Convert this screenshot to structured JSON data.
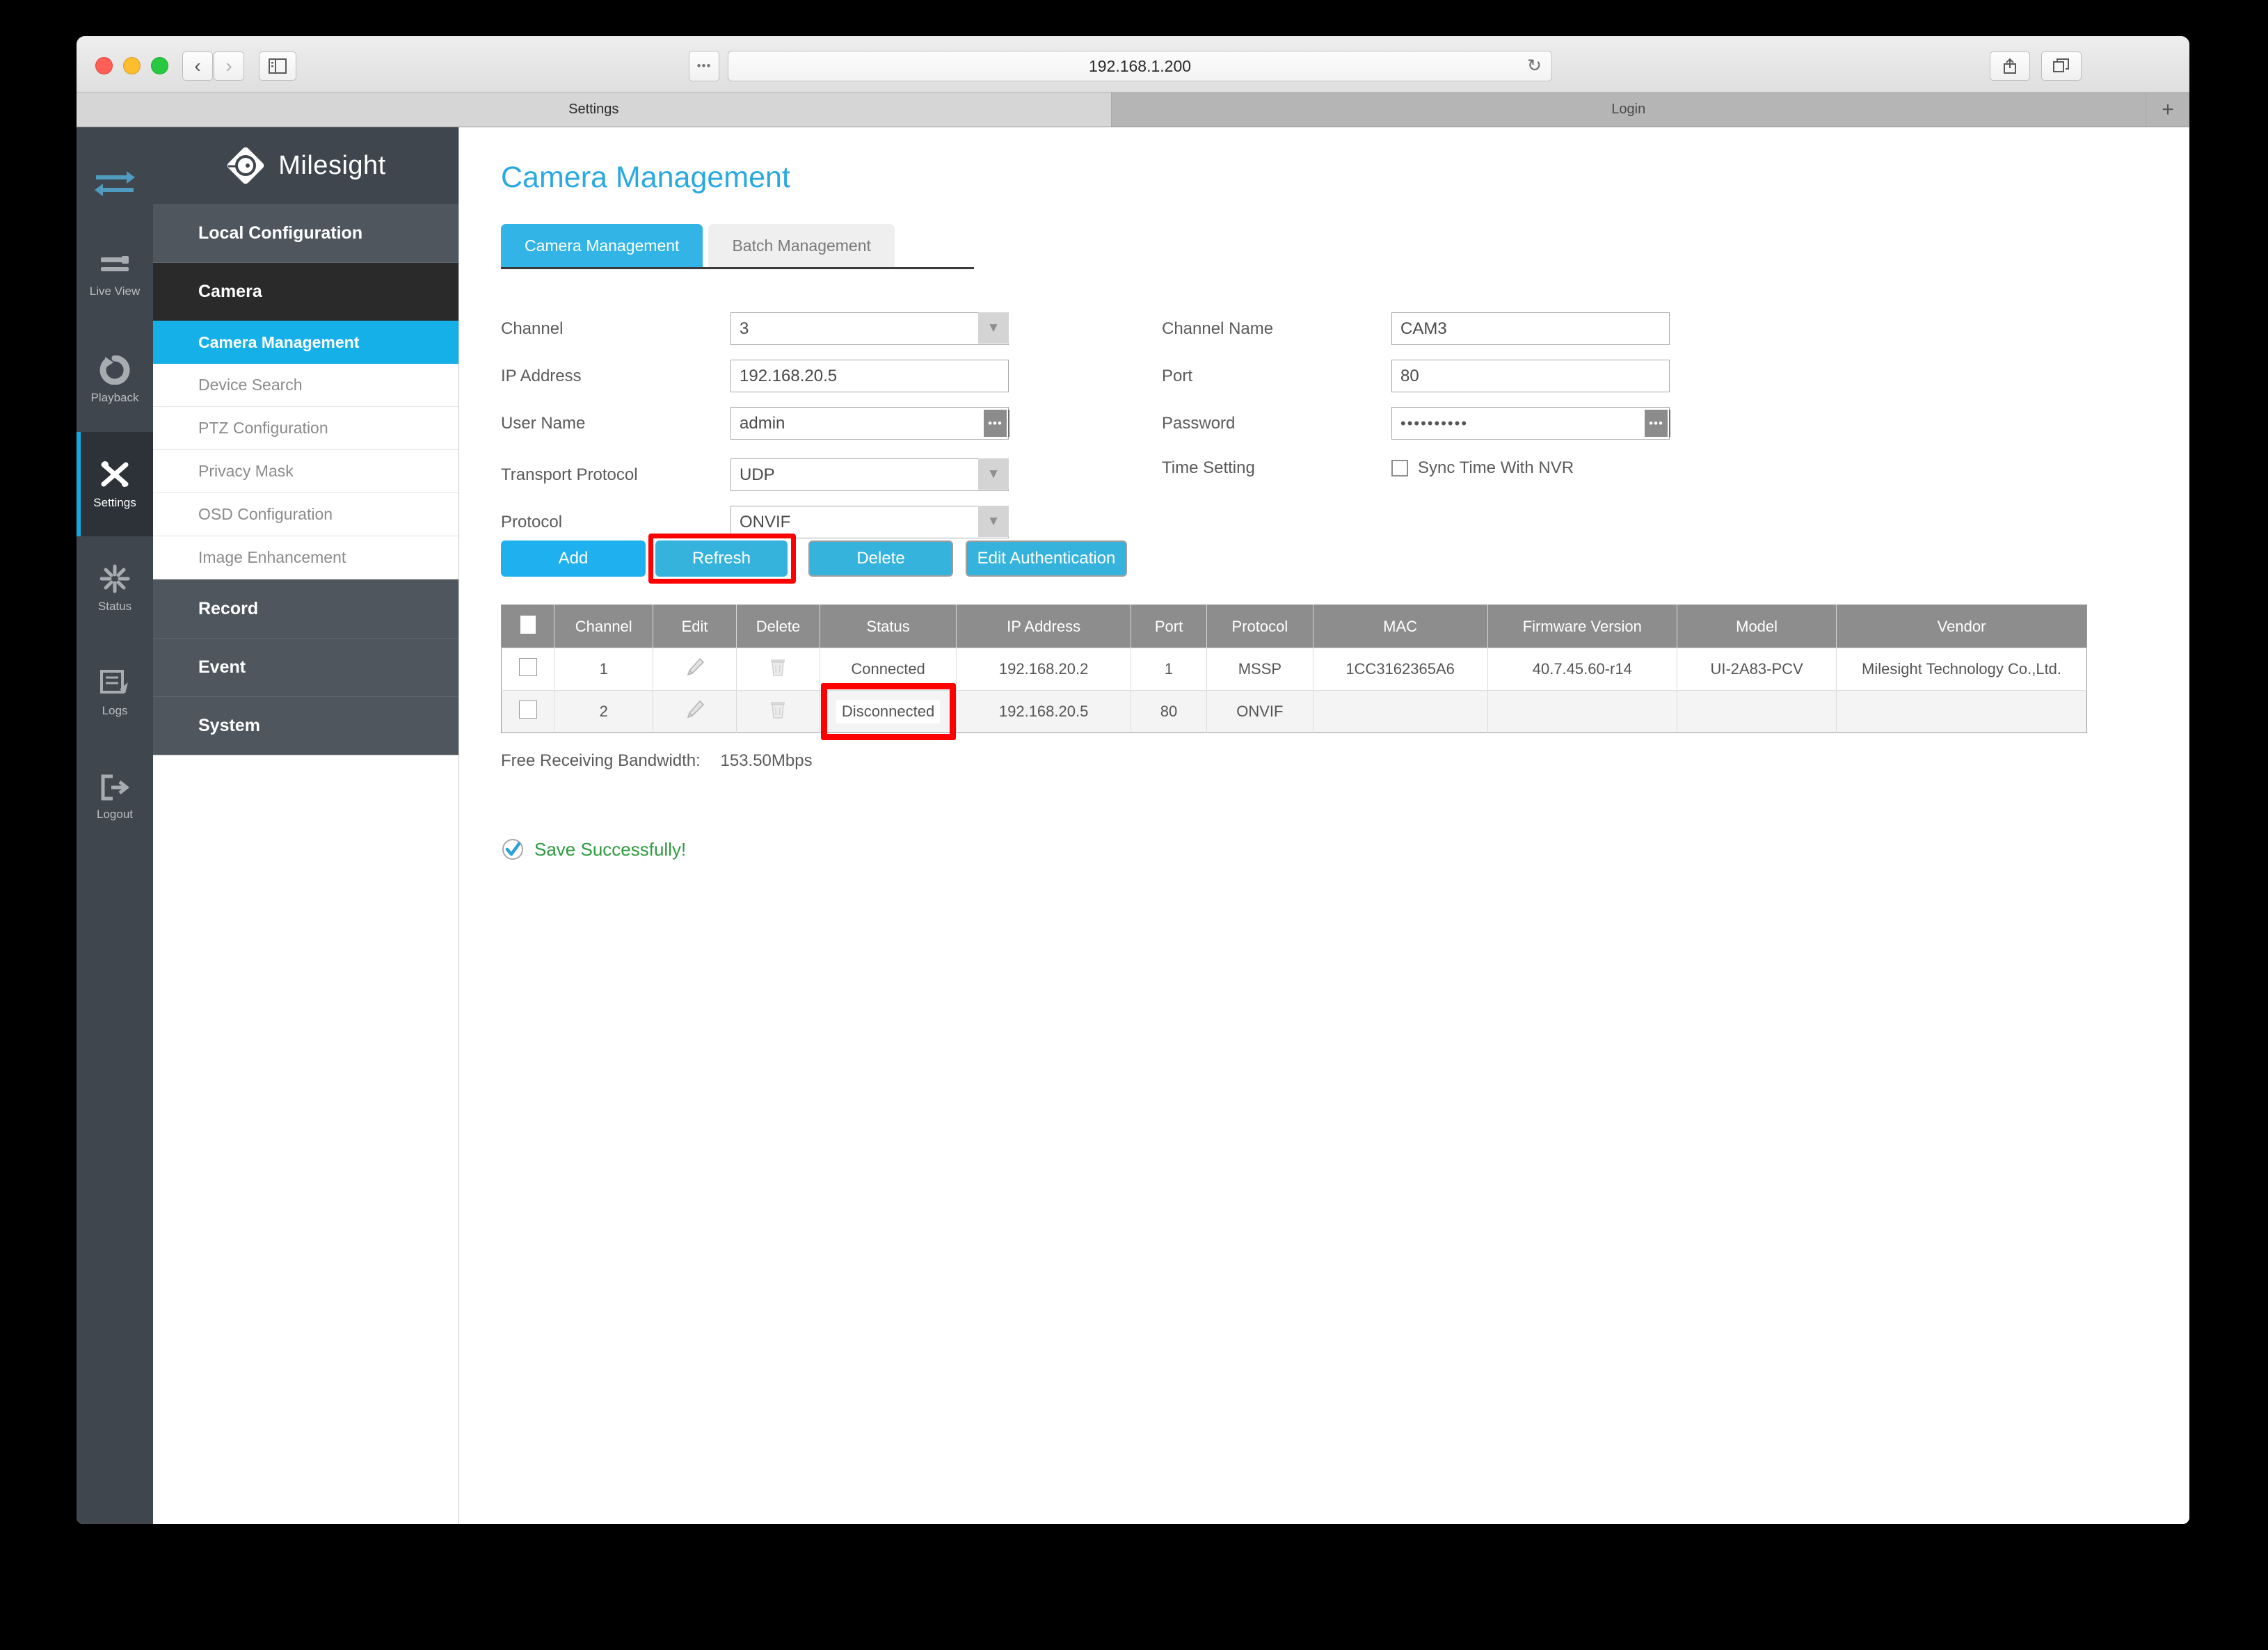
{
  "browser": {
    "url": "192.168.1.200",
    "reload_icon": "reload-icon",
    "back_icon": "chevron-left-icon",
    "forward_icon": "chevron-right-icon",
    "sidebar_icon": "sidebar-toggle-icon",
    "dots_icon": "more-icon",
    "share_icon": "share-icon",
    "tabs_icon": "show-tabs-icon",
    "newtab_label": "+",
    "tabs": [
      {
        "label": "Settings",
        "active": true
      },
      {
        "label": "Login",
        "active": false
      }
    ]
  },
  "rail": {
    "logo_icon": "transfer-arrows-icon",
    "items": [
      {
        "label": "Live View",
        "icon": "live-view-icon",
        "active": false
      },
      {
        "label": "Playback",
        "icon": "playback-icon",
        "active": false
      },
      {
        "label": "Settings",
        "icon": "settings-tools-icon",
        "active": true
      },
      {
        "label": "Status",
        "icon": "status-icon",
        "active": false
      },
      {
        "label": "Logs",
        "icon": "logs-icon",
        "active": false
      },
      {
        "label": "Logout",
        "icon": "logout-icon",
        "active": false
      }
    ]
  },
  "brand": {
    "name": "Milesight",
    "logo_icon": "milesight-logo-icon"
  },
  "nav": {
    "groups": [
      {
        "label": "Local Configuration",
        "open": false
      },
      {
        "label": "Camera",
        "open": true
      },
      {
        "label": "Record",
        "open": false
      },
      {
        "label": "Event",
        "open": false
      },
      {
        "label": "System",
        "open": false
      }
    ],
    "camera_subitems": [
      {
        "label": "Camera Management",
        "active": true
      },
      {
        "label": "Device Search",
        "active": false
      },
      {
        "label": "PTZ Configuration",
        "active": false
      },
      {
        "label": "Privacy Mask",
        "active": false
      },
      {
        "label": "OSD Configuration",
        "active": false
      },
      {
        "label": "Image Enhancement",
        "active": false
      }
    ]
  },
  "page": {
    "title": "Camera Management",
    "tabs": [
      {
        "label": "Camera Management",
        "active": true
      },
      {
        "label": "Batch Management",
        "active": false
      }
    ]
  },
  "form": {
    "channel_label": "Channel",
    "channel_value": "3",
    "ip_label": "IP Address",
    "ip_value": "192.168.20.5",
    "username_label": "User Name",
    "username_value": "admin",
    "transport_label": "Transport Protocol",
    "transport_value": "UDP",
    "protocol_label": "Protocol",
    "protocol_value": "ONVIF",
    "channel_name_label": "Channel Name",
    "channel_name_value": "CAM3",
    "port_label": "Port",
    "port_value": "80",
    "password_label": "Password",
    "password_value": "••••••••••",
    "time_setting_label": "Time Setting",
    "sync_time_label": "Sync Time With NVR",
    "sync_time_checked": false,
    "caret_icon": "chevron-down-icon",
    "dots_icon": "more-dots-icon"
  },
  "buttons": {
    "add": "Add",
    "refresh": "Refresh",
    "delete": "Delete",
    "edit_authentication": "Edit Authentication",
    "highlight_color": "#ff0000"
  },
  "table": {
    "columns": [
      "",
      "Channel",
      "Edit",
      "Delete",
      "Status",
      "IP Address",
      "Port",
      "Protocol",
      "MAC",
      "Firmware Version",
      "Model",
      "Vendor"
    ],
    "rows": [
      {
        "channel": "1",
        "edit_icon": "pencil-icon",
        "delete_icon": "trash-icon",
        "status": "Connected",
        "status_flagged": false,
        "ip_address": "192.168.20.2",
        "port": "1",
        "protocol": "MSSP",
        "mac": "1CC3162365A6",
        "firmware_version": "40.7.45.60-r14",
        "model": "UI-2A83-PCV",
        "vendor": "Milesight Technology Co.,Ltd."
      },
      {
        "channel": "2",
        "edit_icon": "pencil-icon",
        "delete_icon": "trash-icon",
        "status": "Disconnected",
        "status_flagged": true,
        "ip_address": "192.168.20.5",
        "port": "80",
        "protocol": "ONVIF",
        "mac": "",
        "firmware_version": "",
        "model": "",
        "vendor": ""
      }
    ]
  },
  "footer": {
    "bandwidth_label": "Free Receiving Bandwidth:",
    "bandwidth_value": "153.50Mbps",
    "save_message": "Save Successfully!",
    "save_icon": "check-circle-icon",
    "save_color": "#2e9b3f"
  }
}
